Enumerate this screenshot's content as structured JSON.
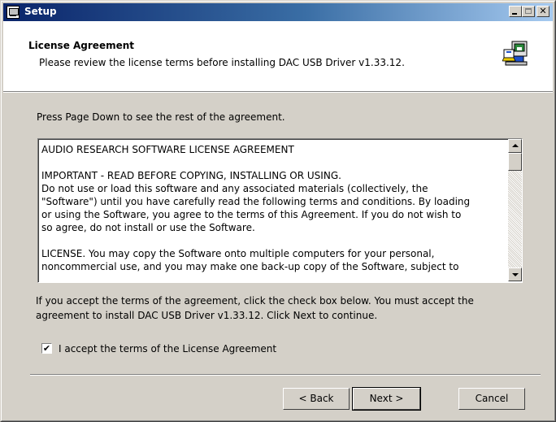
{
  "window": {
    "title": "Setup",
    "controls": {
      "minimize": "_",
      "maximize": "□",
      "close": "✕"
    }
  },
  "header": {
    "title": "License Agreement",
    "subtitle": "Please review the license terms before installing DAC USB Driver v1.33.12.",
    "icon": "setup-installer-icon"
  },
  "instructions": "Press Page Down to see the rest of the agreement.",
  "license": {
    "text": "AUDIO RESEARCH SOFTWARE LICENSE AGREEMENT\n\nIMPORTANT - READ BEFORE COPYING, INSTALLING OR USING.\nDo not use or load this software and any associated materials (collectively, the\n\"Software\") until you have carefully read the following terms and conditions. By loading\nor using the Software, you agree to the terms of this Agreement. If you do not wish to\nso agree, do not install or use the Software.\n\nLICENSE. You may copy the Software onto multiple computers for your personal,\nnoncommercial use, and you may make one back-up copy of the Software, subject to"
  },
  "accept_note": "If you accept the terms of the agreement, click the check box below. You must accept the agreement to install DAC USB Driver v1.33.12. Click Next to continue.",
  "checkbox": {
    "checked": true,
    "mark": "✔",
    "label": "I accept the terms of the License Agreement"
  },
  "buttons": {
    "back": "< Back",
    "next": "Next >",
    "cancel": "Cancel"
  },
  "colors": {
    "titlebar_start": "#0a246a",
    "titlebar_end": "#a6caf0",
    "dialog_bg": "#d4d0c8"
  }
}
